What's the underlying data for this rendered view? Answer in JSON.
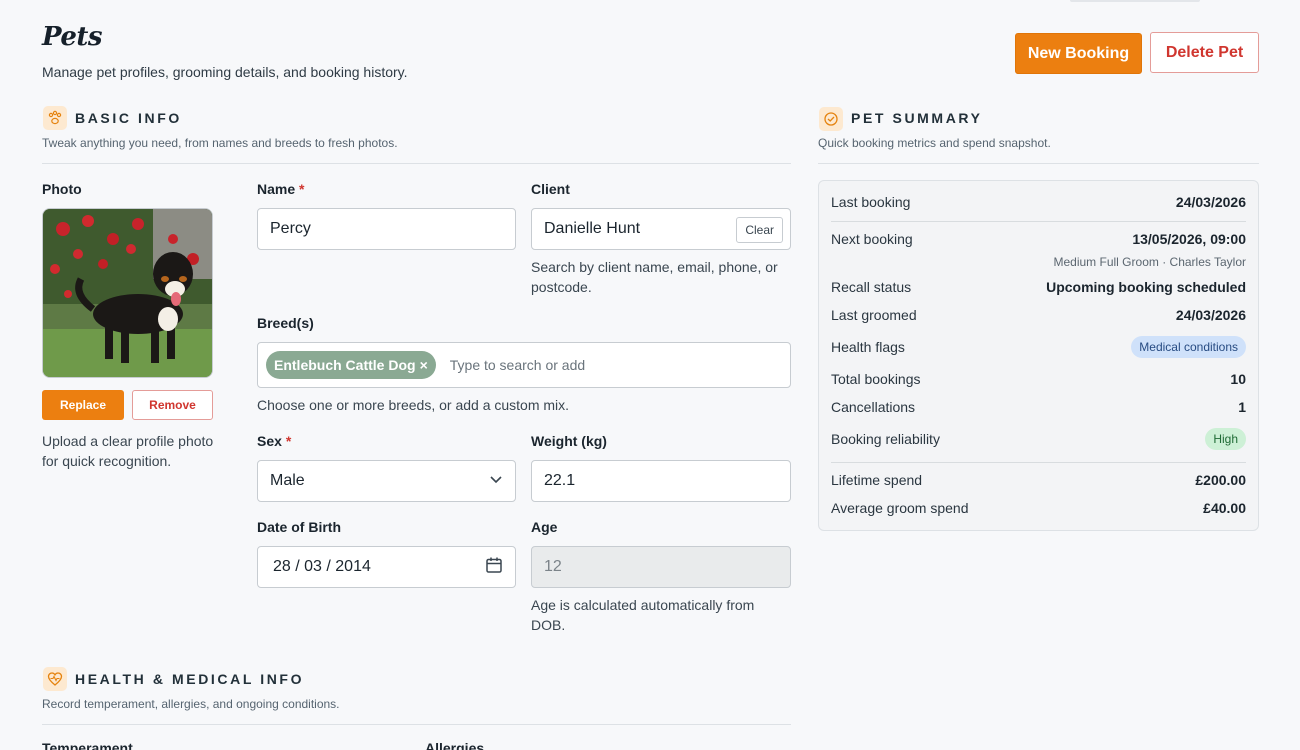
{
  "header": {
    "title": "Pets",
    "subtitle": "Manage pet profiles, grooming details, and booking history.",
    "new_booking": "New Booking",
    "delete_pet": "Delete Pet"
  },
  "basic_info": {
    "title": "BASIC INFO",
    "description": "Tweak anything you need, from names and breeds to fresh photos.",
    "photo_label": "Photo",
    "replace": "Replace",
    "remove": "Remove",
    "photo_hint": "Upload a clear profile photo for quick recognition.",
    "name_label": "Name",
    "name_value": "Percy",
    "client_label": "Client",
    "client_value": "Danielle Hunt",
    "clear": "Clear",
    "client_hint": "Search by client name, email, phone, or postcode.",
    "breeds_label": "Breed(s)",
    "breed_chip": "Entlebuch Cattle Dog",
    "breed_remove": "×",
    "breed_placeholder": "Type to search or add",
    "breeds_hint": "Choose one or more breeds, or add a custom mix.",
    "sex_label": "Sex",
    "sex_value": "Male",
    "weight_label": "Weight (kg)",
    "weight_value": "22.1",
    "dob_label": "Date of Birth",
    "dob_value": "28 / 03 / 2014",
    "age_label": "Age",
    "age_value": "12",
    "age_hint": "Age is calculated automatically from DOB.",
    "required_mark": "*"
  },
  "summary": {
    "title": "PET SUMMARY",
    "description": "Quick booking metrics and spend snapshot.",
    "last_booking_label": "Last booking",
    "last_booking_value": "24/03/2026",
    "next_booking_label": "Next booking",
    "next_booking_value": "13/05/2026, 09:00",
    "next_booking_detail": "Medium Full Groom · Charles Taylor",
    "recall_label": "Recall status",
    "recall_value": "Upcoming booking scheduled",
    "last_groomed_label": "Last groomed",
    "last_groomed_value": "24/03/2026",
    "health_label": "Health flags",
    "health_value": "Medical conditions",
    "total_label": "Total bookings",
    "total_value": "10",
    "cancel_label": "Cancellations",
    "cancel_value": "1",
    "reliability_label": "Booking reliability",
    "reliability_value": "High",
    "lifetime_label": "Lifetime spend",
    "lifetime_value": "£200.00",
    "avg_label": "Average groom spend",
    "avg_value": "£40.00"
  },
  "health": {
    "title": "HEALTH & MEDICAL INFO",
    "description": "Record temperament, allergies, and ongoing conditions.",
    "temperament_label": "Temperament",
    "allergies_label": "Allergies"
  },
  "colors": {
    "accent": "#ec7f10",
    "danger": "#d0362f",
    "chip": "#8aa993"
  },
  "icons": {
    "basic_info": "paw-icon",
    "summary": "check-circle-icon",
    "health": "heart-pulse-icon",
    "sex_dropdown": "chevron-down-icon",
    "dob": "calendar-icon"
  }
}
